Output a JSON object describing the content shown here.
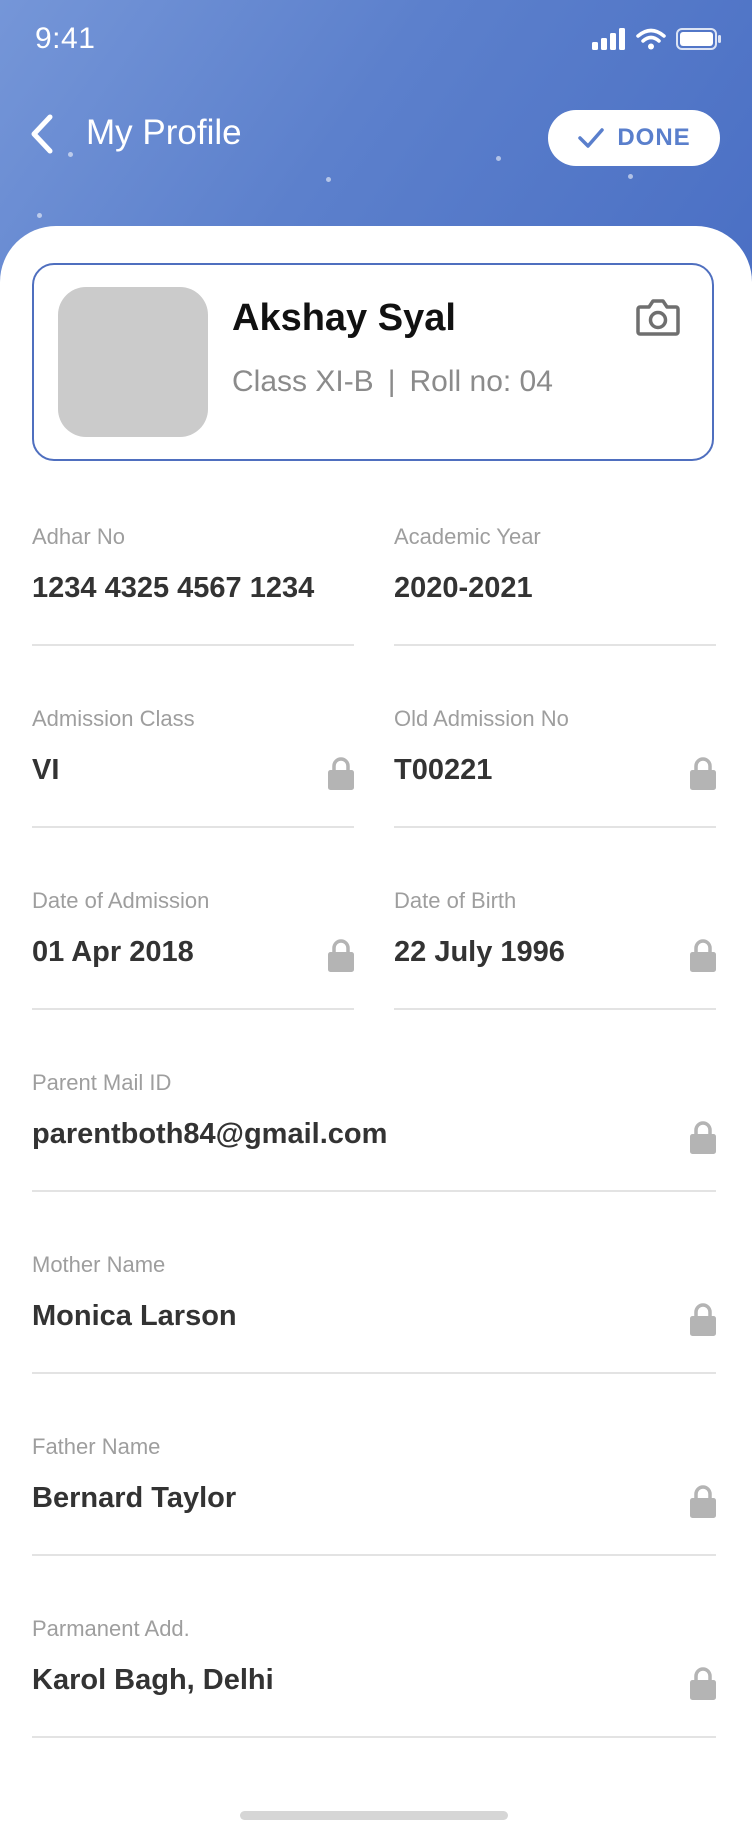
{
  "status_bar": {
    "time": "9:41",
    "icons": [
      "signal-icon",
      "wifi-icon",
      "battery-icon"
    ]
  },
  "nav": {
    "title": "My Profile",
    "done_label": "DONE",
    "back_icon": "chevron-left-icon",
    "done_icon": "check-icon"
  },
  "profile": {
    "name": "Akshay Syal",
    "class": "Class XI-B",
    "separator": "|",
    "roll": "Roll no: 04",
    "camera_icon": "camera-icon"
  },
  "fields": {
    "adhar": {
      "label": "Adhar No",
      "value": "1234 4325 4567 1234",
      "locked": false
    },
    "academic_year": {
      "label": "Academic Year",
      "value": "2020-2021",
      "locked": false
    },
    "admission_class": {
      "label": "Admission Class",
      "value": "VI",
      "locked": true
    },
    "old_admission": {
      "label": "Old Admission No",
      "value": "T00221",
      "locked": true
    },
    "date_admission": {
      "label": "Date of Admission",
      "value": "01 Apr 2018",
      "locked": true
    },
    "dob": {
      "label": "Date of Birth",
      "value": "22 July 1996",
      "locked": true
    },
    "parent_mail": {
      "label": "Parent Mail ID",
      "value": "parentboth84@gmail.com",
      "locked": true
    },
    "mother": {
      "label": "Mother Name",
      "value": "Monica Larson",
      "locked": true
    },
    "father": {
      "label": "Father Name",
      "value": "Bernard Taylor",
      "locked": true
    },
    "address": {
      "label": "Parmanent Add.",
      "value": "Karol Bagh, Delhi",
      "locked": true
    }
  },
  "colors": {
    "header_start": "#7596d8",
    "header_end": "#4a6fc4",
    "accent": "#5a7fcc",
    "label": "#9e9e9e",
    "value": "#333333",
    "lock": "#b4b4b4"
  }
}
